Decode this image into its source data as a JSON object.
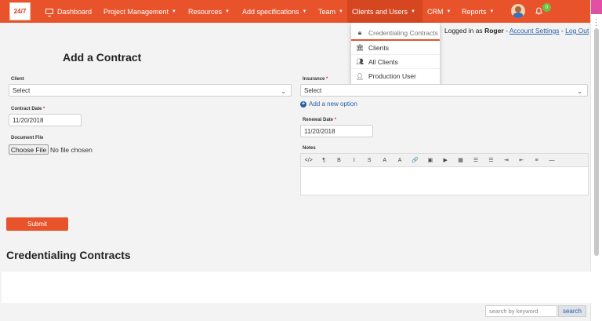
{
  "logo": {
    "text": "24/7"
  },
  "nav": {
    "items": [
      {
        "label": "Dashboard",
        "has_caret": false
      },
      {
        "label": "Project Management",
        "has_caret": true
      },
      {
        "label": "Resources",
        "has_caret": true
      },
      {
        "label": "Add specifications",
        "has_caret": true
      },
      {
        "label": "Team",
        "has_caret": true
      },
      {
        "label": "Clients and Users",
        "has_caret": true
      },
      {
        "label": "CRM",
        "has_caret": true
      },
      {
        "label": "Reports",
        "has_caret": true
      }
    ],
    "notification_count": "0",
    "accent_color": "#e8532b"
  },
  "dropdown": {
    "items": [
      {
        "label": "Credentialing Contracts",
        "icon": "lock-icon"
      },
      {
        "label": "Clients",
        "icon": "bank-icon"
      },
      {
        "label": "All Clients",
        "icon": "users-icon"
      },
      {
        "label": "Production User",
        "icon": "user-plus-icon"
      }
    ]
  },
  "login": {
    "prefix": "Logged in as",
    "user": "Roger",
    "separator": "-",
    "account_settings": "Account Settings",
    "logout": "Log Out"
  },
  "form": {
    "title": "Add a Contract",
    "client": {
      "label": "Client",
      "value": "Select"
    },
    "insurance": {
      "label": "Insurance",
      "required": "*",
      "value": "Select"
    },
    "add_option": "Add a new option",
    "contract_date": {
      "label": "Contract Date",
      "required": "*",
      "value": "11/20/2018"
    },
    "renewal_date": {
      "label": "Renewal Date",
      "required": "*",
      "value": "11/20/2018"
    },
    "document_file": {
      "label": "Document File",
      "button": "Choose File",
      "status": "No file chosen"
    },
    "notes": {
      "label": "Notes"
    },
    "submit": "Submit"
  },
  "editor_toolbar": [
    "</>",
    "¶",
    "B",
    "I",
    "S",
    "A",
    "A",
    "🔗",
    "▣",
    "▶",
    "▦",
    "☰",
    "☰",
    "⇥",
    "⇤",
    "≡",
    "—"
  ],
  "contracts": {
    "title": "Credentialing Contracts",
    "search_placeholder": "search by keyword",
    "search_button": "search"
  }
}
